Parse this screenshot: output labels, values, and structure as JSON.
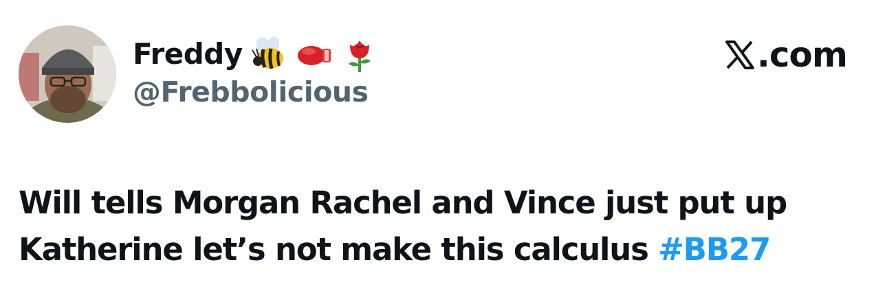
{
  "author": {
    "display_name": "Freddy",
    "name_emojis": [
      "bee-emoji",
      "boxing-glove-emoji",
      "rose-emoji"
    ],
    "handle": "@Frebbolicious"
  },
  "brand": {
    "icon": "x-logo-icon",
    "label": ".com"
  },
  "tweet": {
    "line1": "Will tells Morgan Rachel and Vince just put up",
    "line2": "Katherine let’s not make this calculus",
    "hashtag": "#BB27"
  },
  "colors": {
    "text": "#0f1419",
    "handle": "#536471",
    "hashtag": "#1d9bf0"
  }
}
